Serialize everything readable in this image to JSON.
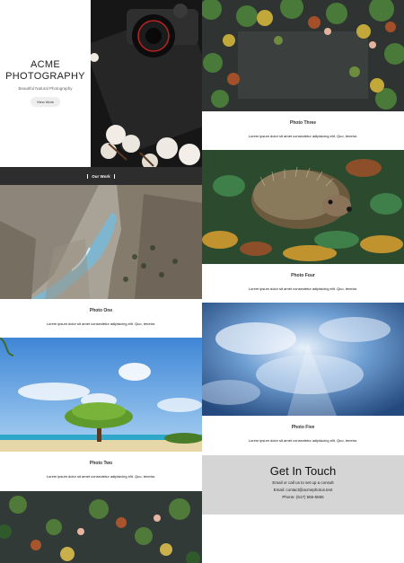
{
  "hero": {
    "title": "ACME PHOTOGRAPHY",
    "subtitle": "Beautiful Natural Photography",
    "button": "View Work"
  },
  "section": {
    "our_work": "Our Work"
  },
  "photos": [
    {
      "title": "Photo One",
      "text": "Lorem ipsum dolor sit amet consectetur adipisicing elit. Quo, tenetur."
    },
    {
      "title": "Photo Two",
      "text": "Lorem ipsum dolor sit amet consectetur adipisicing elit. Quo, tenetur."
    },
    {
      "title": "Photo Three",
      "text": "Lorem ipsum dolor sit amet consectetur adipisicing elit. Quo, tenetur."
    },
    {
      "title": "Photo Four",
      "text": "Lorem ipsum dolor sit amet consectetur adipisicing elit. Quo, tenetur."
    },
    {
      "title": "Photo Five",
      "text": "Lorem ipsum dolor sit amet consectetur adipisicing elit. Quo, tenetur."
    }
  ],
  "contact": {
    "heading": "Get In Touch",
    "line1": "Email or call us to set up a consult",
    "email": "Email: contact@acmephotos.test",
    "phone": "Phone: (617) 555-5555"
  }
}
